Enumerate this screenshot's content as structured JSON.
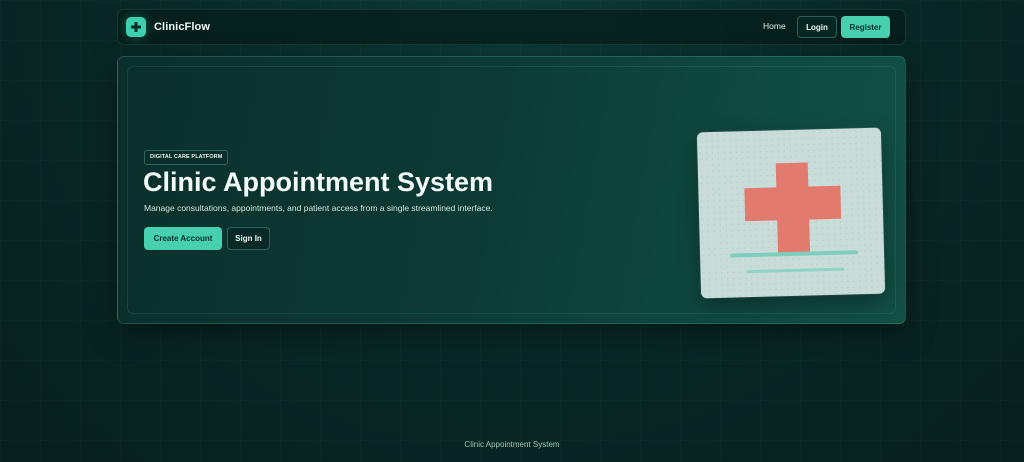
{
  "navbar": {
    "brand_name": "ClinicFlow",
    "brand_icon": "plus-icon",
    "home_label": "Home",
    "login_label": "Login",
    "register_label": "Register"
  },
  "hero": {
    "badge": "DIGITAL CARE PLATFORM",
    "title": "Clinic Appointment System",
    "subtitle": "Manage consultations, appointments, and patient access from a single streamlined interface.",
    "primary_button": "Create Account",
    "secondary_button": "Sign In",
    "illustration": "medical-cross-card-illustration"
  },
  "footer": {
    "text": "Clinic Appointment System"
  },
  "colors": {
    "accent": "#46d0ad",
    "background": "#082724",
    "cross": "#e27b6d",
    "card": "#c9dcd9"
  }
}
